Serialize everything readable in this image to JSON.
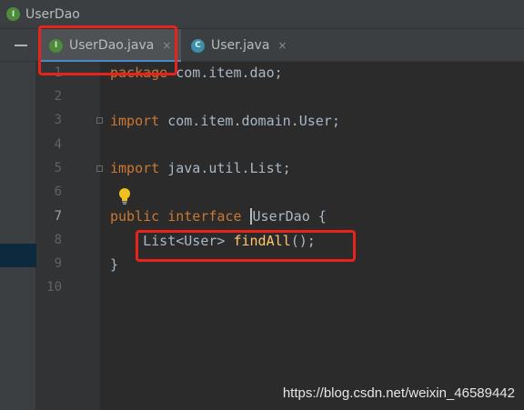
{
  "window": {
    "title": "UserDao",
    "title_icon": "I"
  },
  "tabs": [
    {
      "label": "UserDao.java",
      "icon_letter": "I",
      "icon": "interface-icon",
      "active": true,
      "close": "×"
    },
    {
      "label": "User.java",
      "icon_letter": "C",
      "icon": "class-icon",
      "active": false,
      "close": "×"
    }
  ],
  "editor": {
    "line_numbers": [
      "1",
      "2",
      "3",
      "4",
      "5",
      "6",
      "7",
      "8",
      "9",
      "10"
    ],
    "current_line": "7",
    "lines": {
      "l1": {
        "kw": "package",
        "rest": " com.item.dao;"
      },
      "l3": {
        "kw": "import",
        "rest": " com.item.domain.User;"
      },
      "l5": {
        "kw": "import",
        "rest": " java.util.List;"
      },
      "l7": {
        "kw1": "public",
        "kw2": "interface",
        "name": "UserDao",
        "rest": " {"
      },
      "l8": {
        "indent": "    ",
        "type": "List<User> ",
        "method": "findAll",
        "rest": "();"
      },
      "l9": {
        "text": "}"
      }
    }
  },
  "colors": {
    "keyword": "#cc7832",
    "method": "#ffc66d",
    "text": "#a9b7c6",
    "highlight_box": "#e8231c",
    "background": "#2b2b2b"
  },
  "watermark": "https://blog.csdn.net/weixin_46589442"
}
